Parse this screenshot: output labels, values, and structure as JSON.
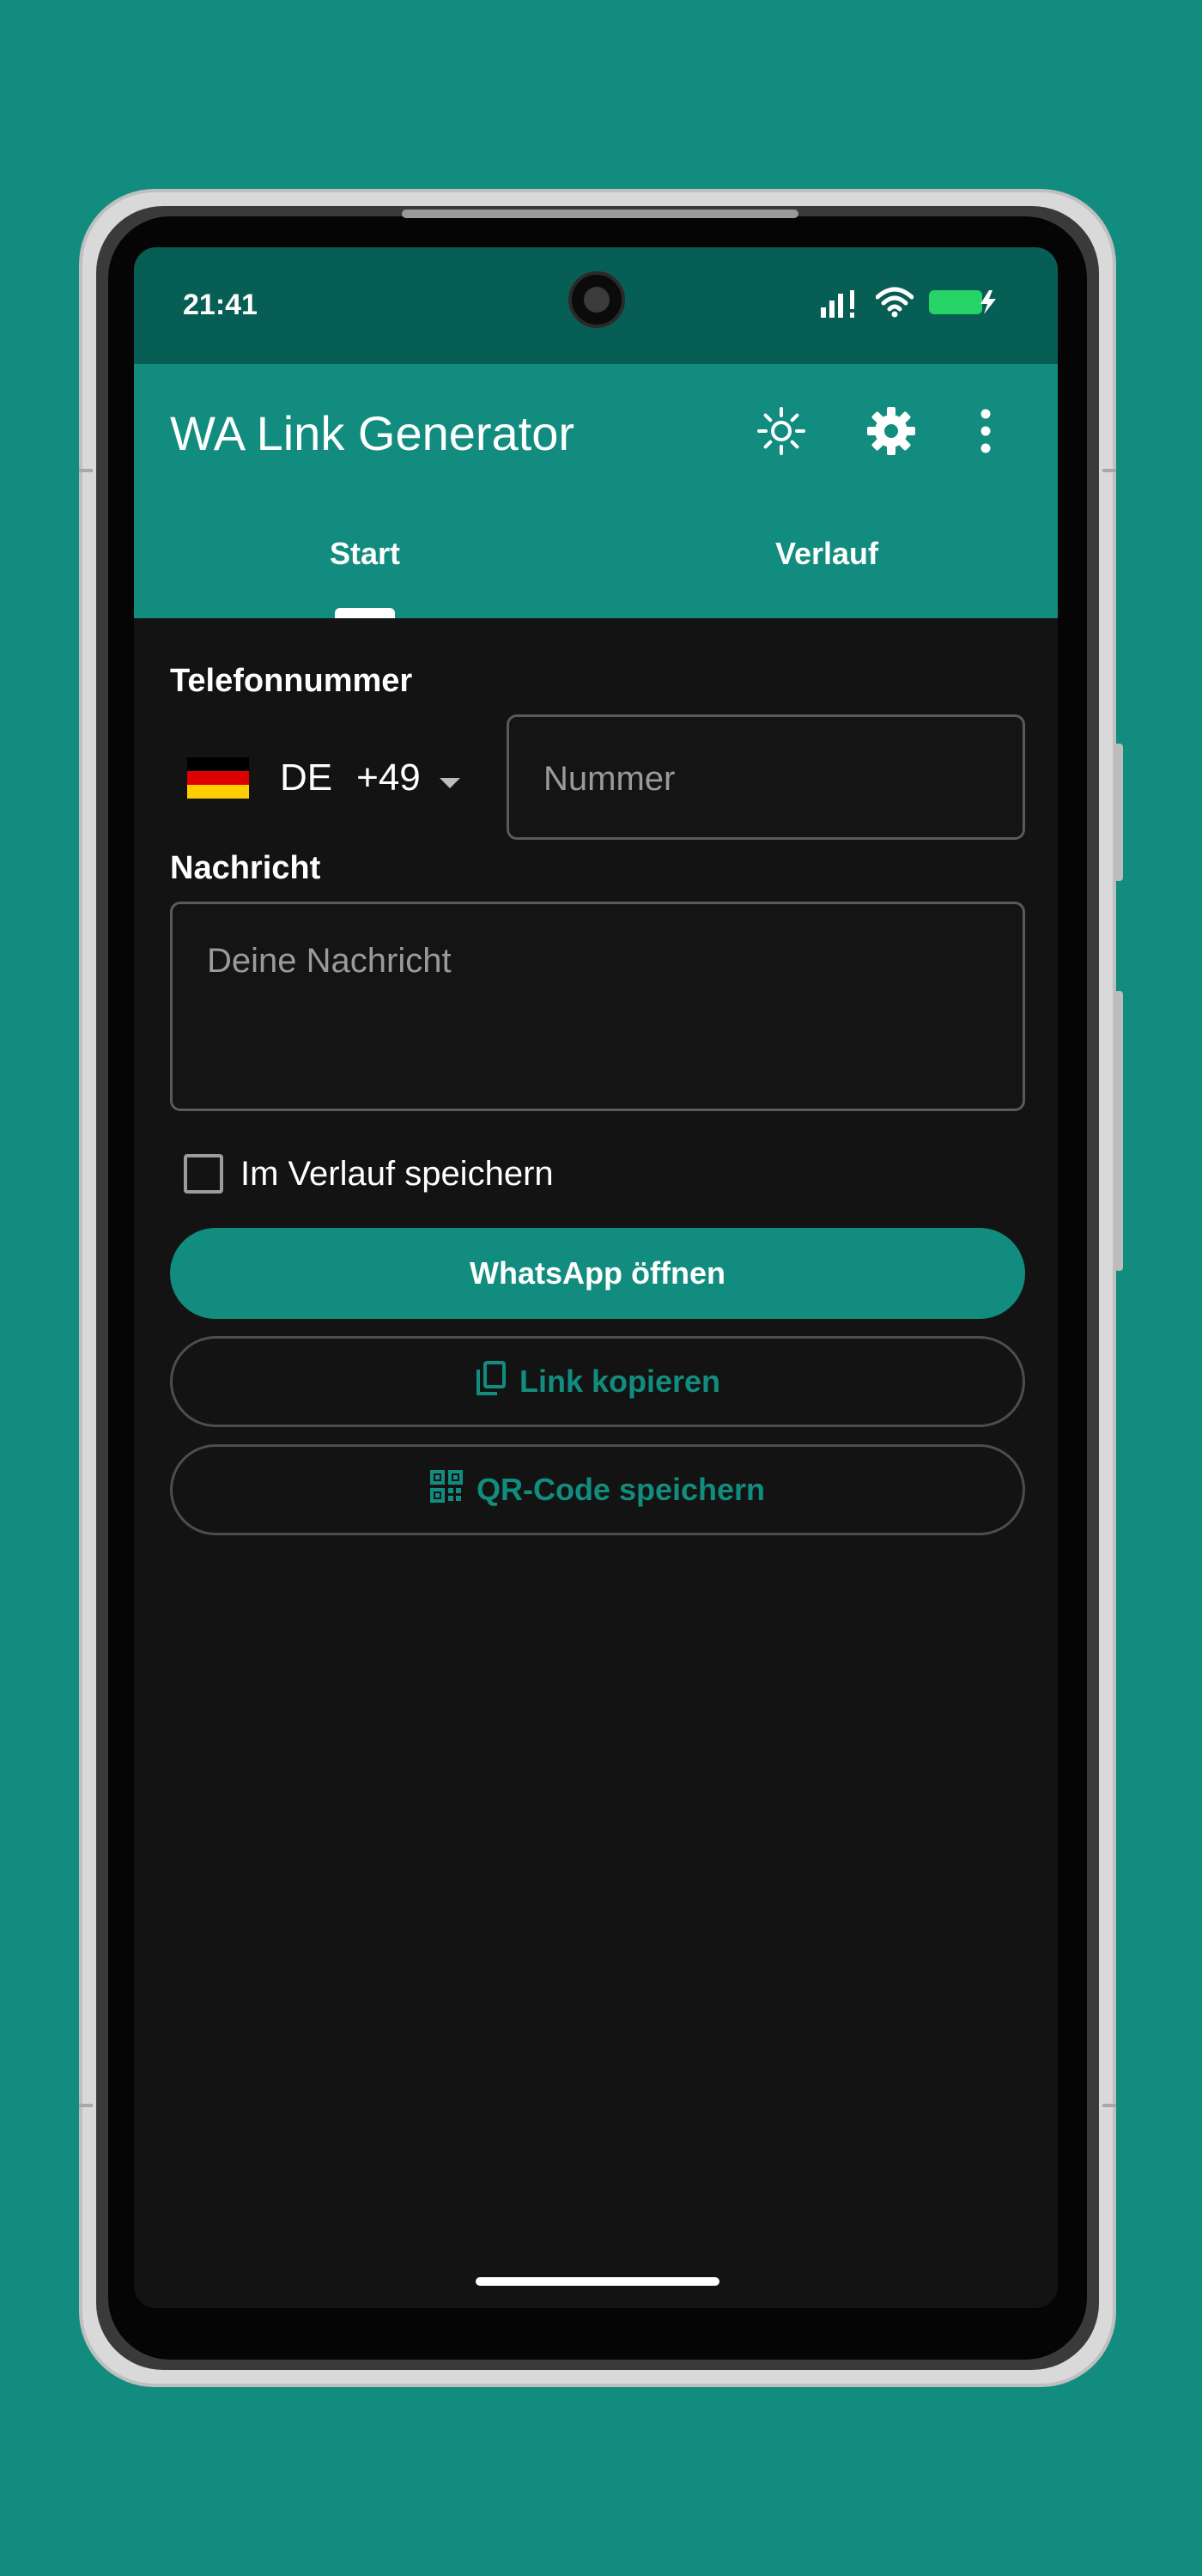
{
  "status_bar": {
    "time": "21:41"
  },
  "app_bar": {
    "title": "WA Link Generator",
    "theme_icon": "sun-icon",
    "settings_icon": "gear-icon",
    "menu_icon": "more-vertical-icon"
  },
  "tabs": [
    {
      "label": "Start",
      "selected": true
    },
    {
      "label": "Verlauf",
      "selected": false
    }
  ],
  "form": {
    "phone_label": "Telefonnummer",
    "country_code": "DE",
    "dial_code": "+49",
    "number_placeholder": "Nummer",
    "message_label": "Nachricht",
    "message_placeholder": "Deine Nachricht",
    "save_history_label": "Im Verlauf speichern",
    "save_history_checked": false
  },
  "actions": {
    "open_whatsapp": "WhatsApp öffnen",
    "copy_link": "Link kopieren",
    "save_qr": "QR-Code speichern"
  },
  "colors": {
    "primary": "#128c7e",
    "status_bar": "#075e54",
    "background": "#131313",
    "battery": "#25d366"
  }
}
